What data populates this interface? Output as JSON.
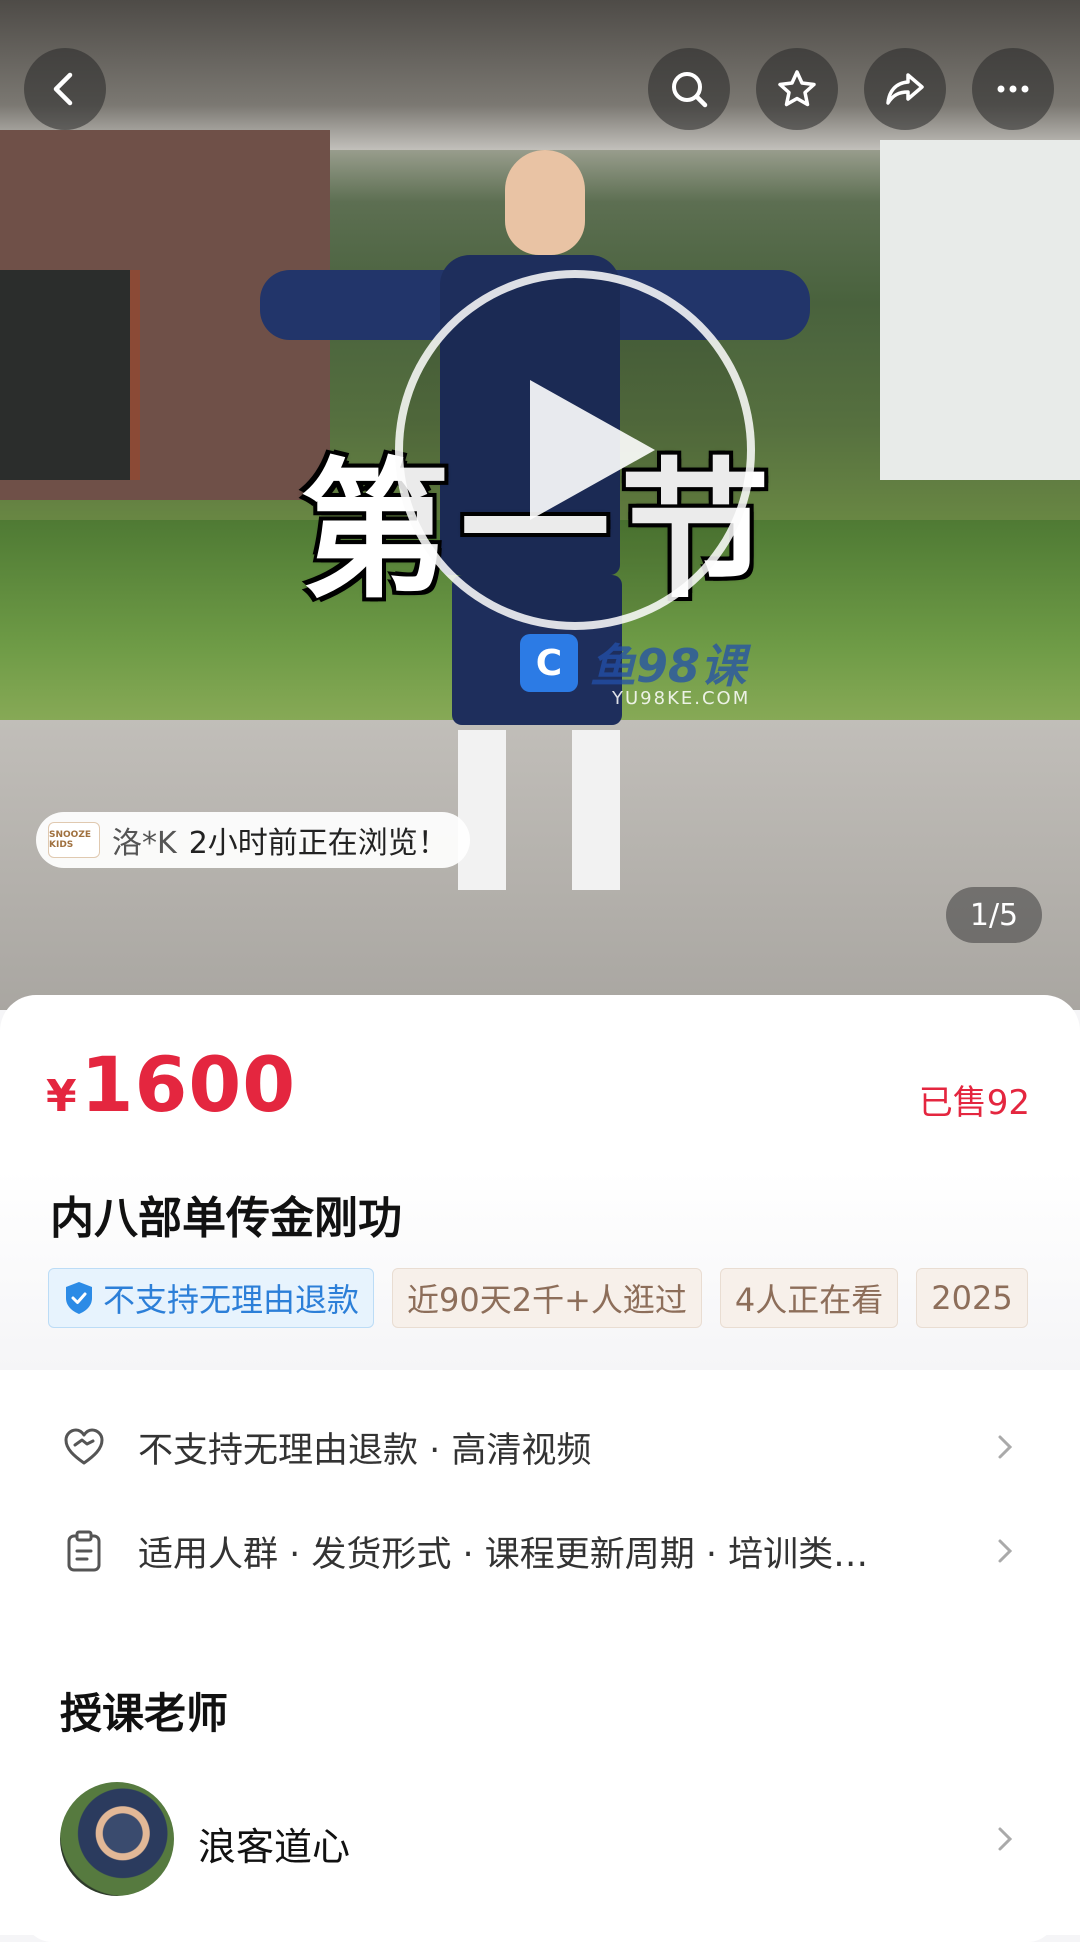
{
  "hero": {
    "overlay_title": "第一节",
    "watermark": {
      "logo_letter": "C",
      "text": "鱼98课",
      "sub": "YU98KE.COM"
    },
    "browse": {
      "nick": "洛*K",
      "msg": "2小时前正在浏览！",
      "avatar_text": "SNOOZE KIDS"
    },
    "page_indicator": "1/5"
  },
  "top_bar": {
    "icons": [
      "back-icon",
      "search-icon",
      "star-icon",
      "share-icon",
      "more-icon"
    ]
  },
  "product": {
    "currency": "¥",
    "price": "1600",
    "sold": "已售92",
    "title": "内八部单传金刚功",
    "tags": [
      "不支持无理由退款",
      "近90天2千+人逛过",
      "4人正在看",
      "2025"
    ]
  },
  "info_rows": [
    {
      "icon": "heart-service-icon",
      "text": "不支持无理由退款 · 高清视频"
    },
    {
      "icon": "clipboard-icon",
      "text": "适用人群 · 发货形式 · 课程更新周期 · 培训类…"
    }
  ],
  "teacher": {
    "section_title": "授课老师",
    "name": "浪客道心"
  },
  "colors": {
    "accent": "#e4263f",
    "tag_blue": "#2c7fd8",
    "tag_brown": "#8d6e5a"
  }
}
